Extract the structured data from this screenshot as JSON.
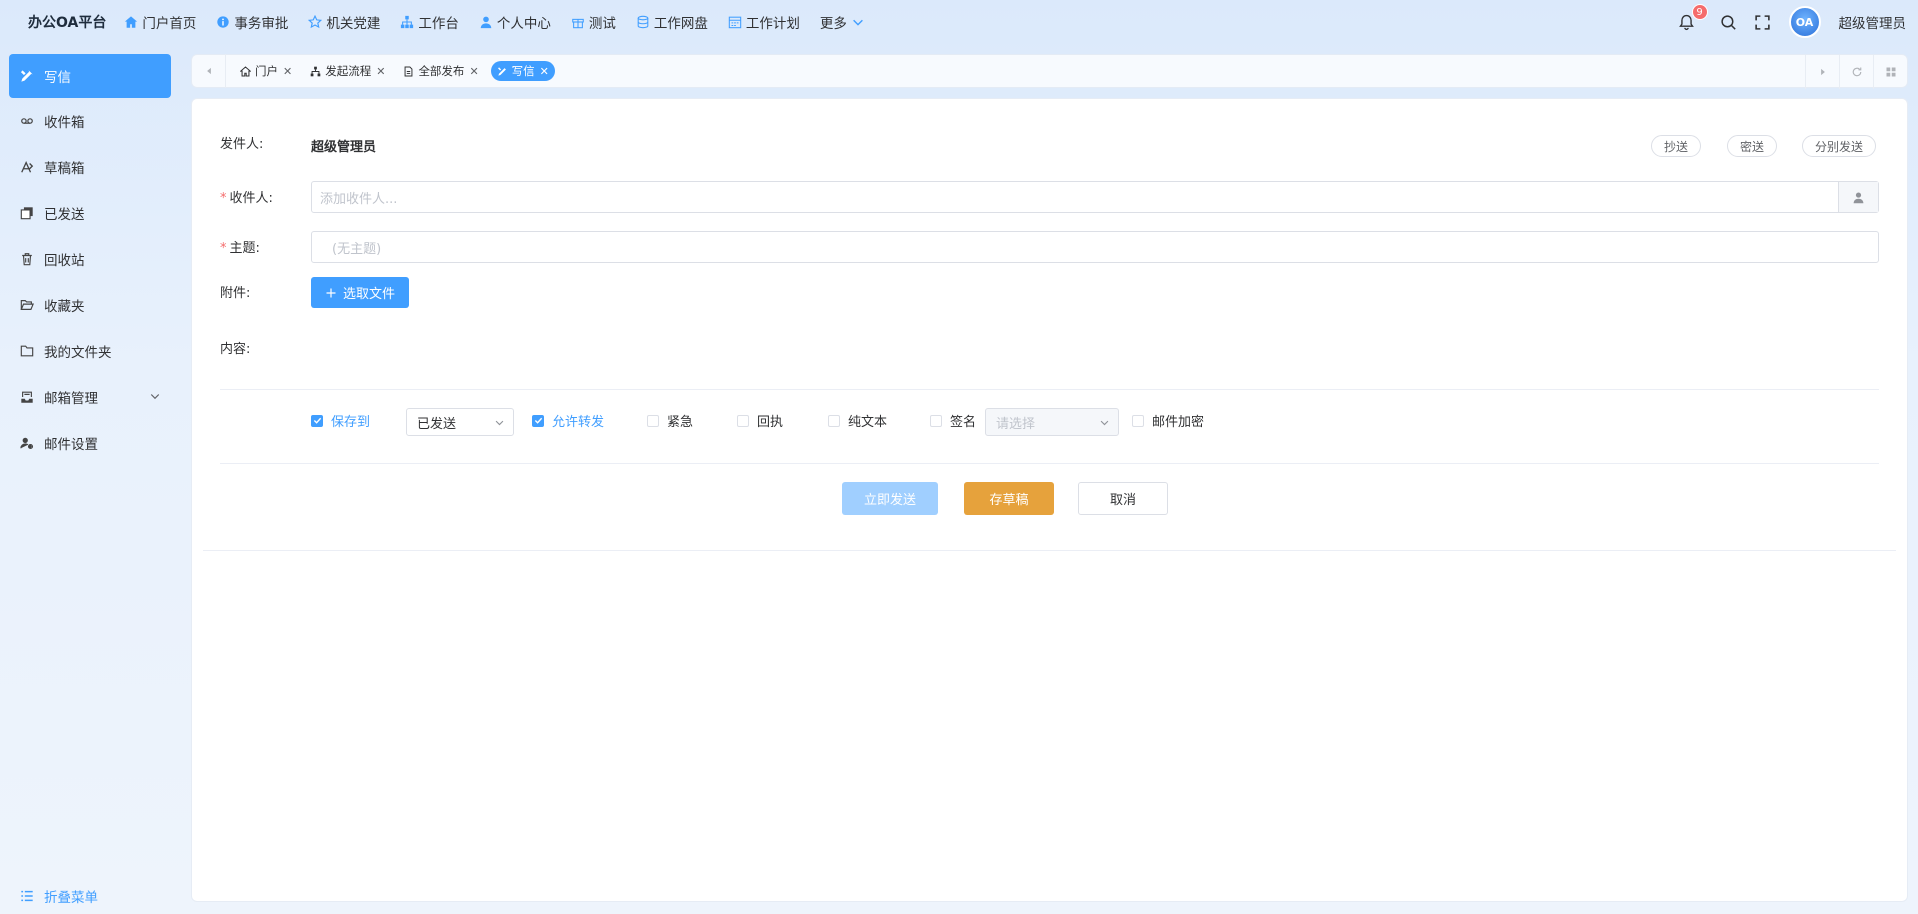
{
  "app": {
    "brand": "办公OA平台",
    "username": "超级管理员",
    "notifications": "9",
    "avatar_text": "OA"
  },
  "topnav": [
    {
      "label": "门户首页",
      "icon": "home-icon"
    },
    {
      "label": "事务审批",
      "icon": "info-circle-icon"
    },
    {
      "label": "机关党建",
      "icon": "star-icon"
    },
    {
      "label": "工作台",
      "icon": "org-chart-icon"
    },
    {
      "label": "个人中心",
      "icon": "user-icon"
    },
    {
      "label": "测试",
      "icon": "gift-icon"
    },
    {
      "label": "工作网盘",
      "icon": "database-icon"
    },
    {
      "label": "工作计划",
      "icon": "calendar-icon"
    },
    {
      "label": "更多",
      "icon": "chevron-down-icon"
    }
  ],
  "sidebar": {
    "items": [
      {
        "label": "写信",
        "icon": "edit-tools-icon",
        "active": true
      },
      {
        "label": "收件箱",
        "icon": "voicemail-icon"
      },
      {
        "label": "草稿箱",
        "icon": "draft-icon"
      },
      {
        "label": "已发送",
        "icon": "copy-icon"
      },
      {
        "label": "回收站",
        "icon": "trash-icon"
      },
      {
        "label": "收藏夹",
        "icon": "folder-open-icon"
      },
      {
        "label": "我的文件夹",
        "icon": "folder-icon"
      },
      {
        "label": "邮箱管理",
        "icon": "inbox-tray-icon",
        "expandable": true
      },
      {
        "label": "邮件设置",
        "icon": "user-settings-icon"
      }
    ],
    "collapse_label": "折叠菜单"
  },
  "tabs": [
    {
      "label": "门户",
      "icon": "home-icon"
    },
    {
      "label": "发起流程",
      "icon": "org-chart-icon"
    },
    {
      "label": "全部发布",
      "icon": "file-icon"
    },
    {
      "label": "写信",
      "icon": "edit-tools-icon",
      "active": true
    }
  ],
  "form": {
    "sender_label": "发件人:",
    "sender_value": "超级管理员",
    "cc_button": "抄送",
    "bcc_button": "密送",
    "separate_send_button": "分别发送",
    "recipient_label": "收件人:",
    "recipient_placeholder": "添加收件人...",
    "subject_label": "主题:",
    "subject_placeholder": "(无主题)",
    "attachment_label": "附件:",
    "choose_file_button": "选取文件",
    "content_label": "内容:"
  },
  "options": {
    "save_to_label": "保存到",
    "save_to_checked": true,
    "save_to_folder": "已发送",
    "allow_forward_label": "允许转发",
    "allow_forward_checked": true,
    "urgent_label": "紧急",
    "receipt_label": "回执",
    "plain_text_label": "纯文本",
    "signature_label": "签名",
    "signature_placeholder": "请选择",
    "encrypt_label": "邮件加密"
  },
  "actions": {
    "send_now": "立即发送",
    "save_draft": "存草稿",
    "cancel": "取消"
  },
  "colors": {
    "primary": "#409eff",
    "warning": "#e6a23c",
    "danger": "#f56c6c",
    "disabled_primary": "#a0cfff"
  }
}
